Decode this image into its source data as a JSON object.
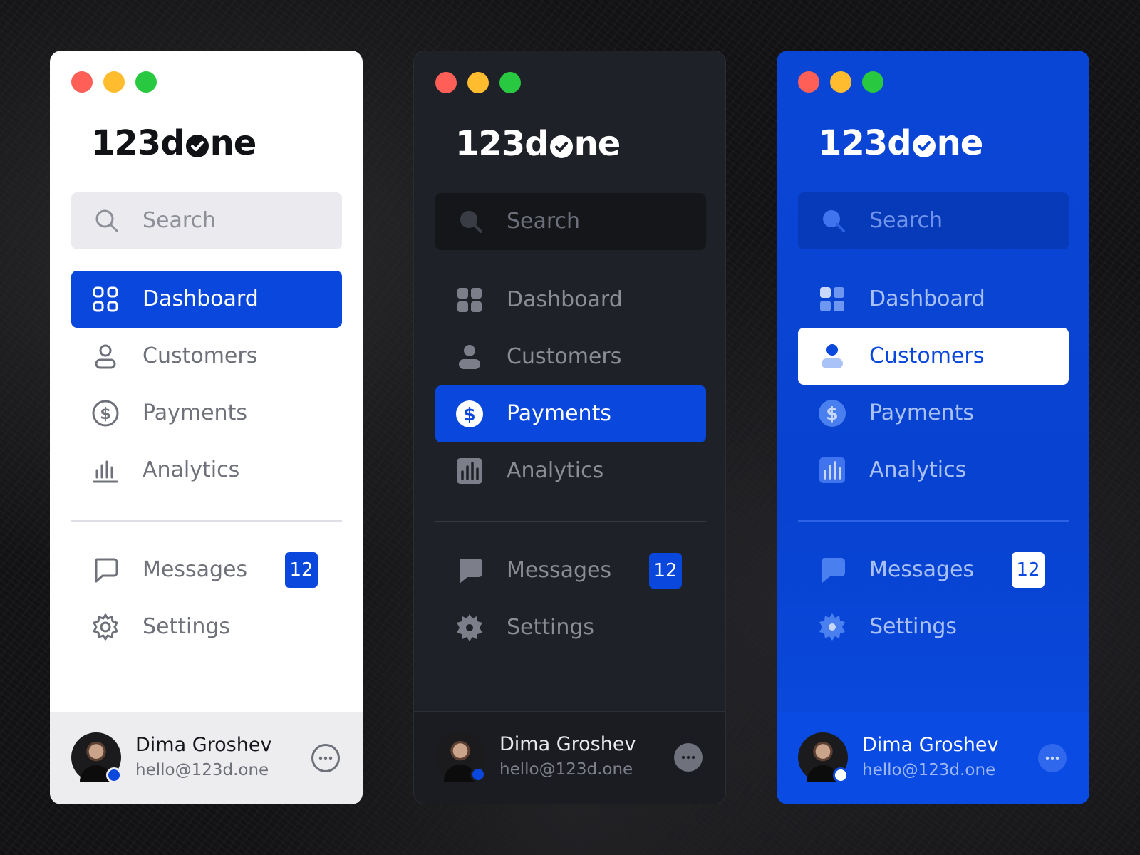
{
  "brand": {
    "logo_prefix": "123d",
    "logo_suffix": "ne"
  },
  "search": {
    "placeholder": "Search"
  },
  "nav": {
    "dashboard": "Dashboard",
    "customers": "Customers",
    "payments": "Payments",
    "analytics": "Analytics",
    "messages": "Messages",
    "settings": "Settings"
  },
  "messages_badge": "12",
  "user": {
    "name": "Dima Groshev",
    "email": "hello@123d.one"
  },
  "themes": [
    {
      "name": "light",
      "active_item": "dashboard"
    },
    {
      "name": "dark",
      "active_item": "payments"
    },
    {
      "name": "blue",
      "active_item": "customers"
    }
  ],
  "icons": [
    "search-icon",
    "dashboard-icon",
    "customers-icon",
    "payments-icon",
    "analytics-icon",
    "messages-icon",
    "settings-icon",
    "more-icon"
  ],
  "colors": {
    "accent": "#0a47dc",
    "light_bg": "#ffffff",
    "dark_bg": "#1f2128",
    "blue_bg": "#0a46d6"
  }
}
